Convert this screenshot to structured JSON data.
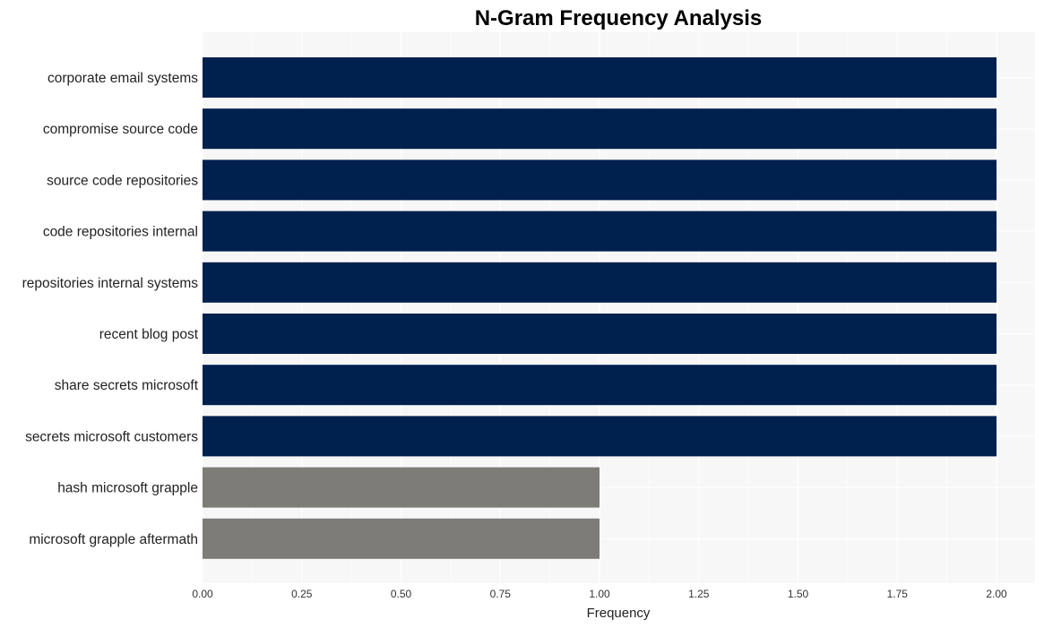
{
  "chart_data": {
    "type": "bar",
    "orientation": "horizontal",
    "title": "N-Gram Frequency Analysis",
    "xlabel": "Frequency",
    "ylabel": "",
    "xlim": [
      0,
      2.1
    ],
    "xticks": [
      "0.00",
      "0.25",
      "0.50",
      "0.75",
      "1.00",
      "1.25",
      "1.50",
      "1.75",
      "2.00"
    ],
    "xtick_values": [
      0,
      0.25,
      0.5,
      0.75,
      1.0,
      1.25,
      1.5,
      1.75,
      2.0
    ],
    "grid": true,
    "categories": [
      "corporate email systems",
      "compromise source code",
      "source code repositories",
      "code repositories internal",
      "repositories internal systems",
      "recent blog post",
      "share secrets microsoft",
      "secrets microsoft customers",
      "hash microsoft grapple",
      "microsoft grapple aftermath"
    ],
    "values": [
      2,
      2,
      2,
      2,
      2,
      2,
      2,
      2,
      1,
      1
    ],
    "colors": {
      "high": "#00204e",
      "low": "#7d7c78",
      "plot_bg": "#f7f7f7",
      "grid": "#ffffff"
    }
  }
}
